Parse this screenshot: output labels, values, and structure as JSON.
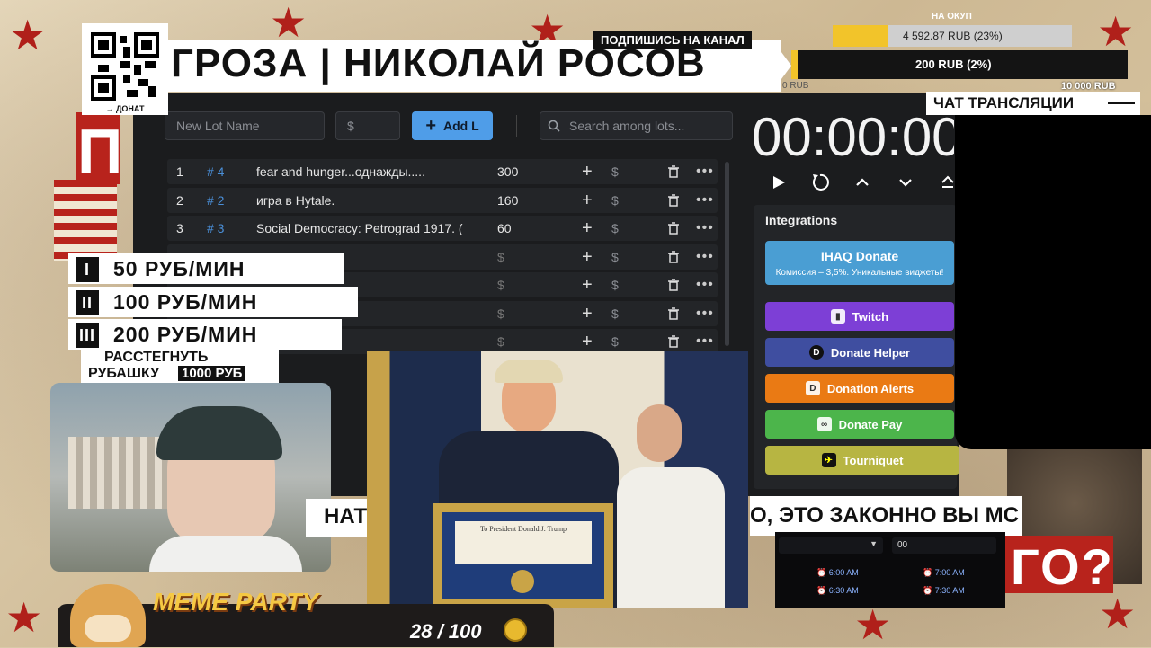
{
  "header": {
    "title": "ГРОЗА | НИКОЛАЙ РОСОВ",
    "subscribe": "ПОДПИШИСЬ НА КАНАЛ",
    "qr_caption": "→ ДОНАТ"
  },
  "goal": {
    "label_top": "НА ОКУП",
    "amount1": "4 592.87 RUB (23%)",
    "progress1": 0.23,
    "amount2": "200 RUB (2%)",
    "progress2": 0.02,
    "min_label": "0 RUB",
    "max_label": "10 000 RUB",
    "chat_title": "ЧАТ ТРАНСЛЯЦИИ"
  },
  "toolbar": {
    "lot_name_placeholder": "New Lot Name",
    "price_placeholder": "$",
    "add_label": "Add L",
    "search_placeholder": "Search among lots..."
  },
  "lots": [
    {
      "n": "1",
      "id": "# 4",
      "name": "fear and hunger...однажды.....",
      "amount": "300"
    },
    {
      "n": "2",
      "id": "# 2",
      "name": "игра в Hytale.",
      "amount": "160"
    },
    {
      "n": "3",
      "id": "# 3",
      "name": "Social Democracy: Petrograd 1917. (",
      "amount": "60"
    },
    {
      "n": "",
      "id": "",
      "name": "",
      "amount": "$"
    },
    {
      "n": "",
      "id": "",
      "name": "",
      "amount": "$"
    },
    {
      "n": "",
      "id": "",
      "name": "",
      "amount": "$"
    },
    {
      "n": "",
      "id": "",
      "name": "",
      "amount": "$"
    }
  ],
  "timer": {
    "value": "00:00:00"
  },
  "integrations": {
    "title": "Integrations",
    "ihaq_label": "IHAQ Donate",
    "ihaq_sub": "Комиссия – 3,5%. Уникальные виджеты!",
    "buttons": [
      {
        "label": "Twitch",
        "color": "#7d3fd6",
        "icon": "twitch-icon"
      },
      {
        "label": "Donate Helper",
        "color": "#3f4ea0",
        "icon": "donate-helper-icon"
      },
      {
        "label": "Donation Alerts",
        "color": "#ea7a14",
        "icon": "donation-alerts-icon"
      },
      {
        "label": "Donate Pay",
        "color": "#4cb54b",
        "icon": "donate-pay-icon"
      },
      {
        "label": "Tourniquet",
        "color": "#b7b542",
        "icon": "tourniquet-icon"
      }
    ]
  },
  "prices": [
    {
      "num": "I",
      "label": "50 РУБ/МИН"
    },
    {
      "num": "II",
      "label": "100 РУБ/МИН"
    },
    {
      "num": "III",
      "label": "200 РУБ/МИН"
    }
  ],
  "shirt": {
    "line1": "РАССТЕГНУТЬ",
    "line2": "РУБАШКУ",
    "price": "1000 РУБ"
  },
  "ticker": {
    "left": "НАТ",
    "right": "О, ЭТО ЗАКОННО ВЫ МС"
  },
  "poster_words": {
    "left": "П",
    "right": "ГО?"
  },
  "alarms": {
    "hour": "00",
    "times": [
      "6:00 AM",
      "7:00 AM",
      "6:30 AM",
      "7:30 AM"
    ]
  },
  "meme": {
    "title": "MEME PARTY",
    "count": "28 / 100"
  },
  "photo": {
    "plaque": "To President Donald J. Trump"
  },
  "colors": {
    "accent": "#4f9de8",
    "red": "#b8231c",
    "app_bg": "#1b1c1e"
  }
}
